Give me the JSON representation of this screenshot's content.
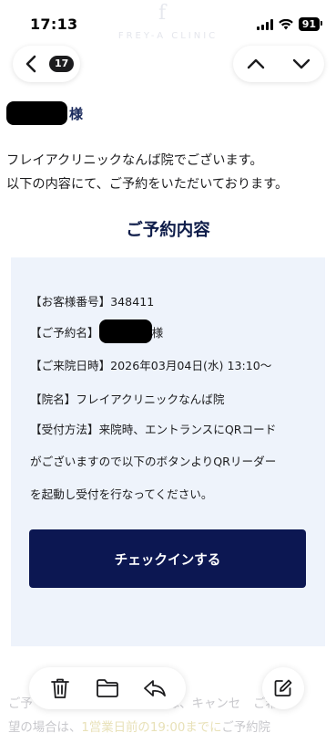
{
  "status_bar": {
    "time": "17:13",
    "battery": "91"
  },
  "brand": {
    "watermark_text": "FREY-A CLINIC",
    "logo_glyph": "f"
  },
  "nav": {
    "unread_count": "17",
    "icons": [
      "chevron-left-icon",
      "chevron-up-icon",
      "chevron-down-icon"
    ]
  },
  "email": {
    "recipient_suffix": "様",
    "intro_line1": "フレイアクリニックなんば院でございます。",
    "intro_line2": "以下の内容にて、ご予約をいただいております。",
    "section_title": "ご予約内容",
    "details": {
      "customer_number": "【お客様番号】348411",
      "reservation_name_label": "【ご予約名】",
      "reservation_name_suffix": "様",
      "visit_datetime": "【ご来院日時】2026年03月04日(水) 13:10〜",
      "clinic_name": "【院名】フレイアクリニックなんば院",
      "reception_line1": "【受付方法】来院時、エントランスにQRコード",
      "reception_line2": "がございますので以下のボタンよりQRリーダー",
      "reception_line3": "を起動し受付を行なってください。"
    },
    "checkin_button": "チェックインする",
    "footer_line1_a": "ご予",
    "footer_line1_b": "は、キャンセ",
    "footer_line1_c": "ご希",
    "footer_line2_a": "望の場合は、",
    "footer_line2_b": "1営業日前の19:00までに",
    "footer_line2_c": "ご予約院"
  },
  "toolbar": {
    "icons": [
      "trash-icon",
      "folder-icon",
      "reply-icon",
      "compose-icon"
    ]
  },
  "colors": {
    "navy": "#0c1752",
    "title_navy": "#0f1d4a",
    "panel_bg": "#eef3fb"
  }
}
